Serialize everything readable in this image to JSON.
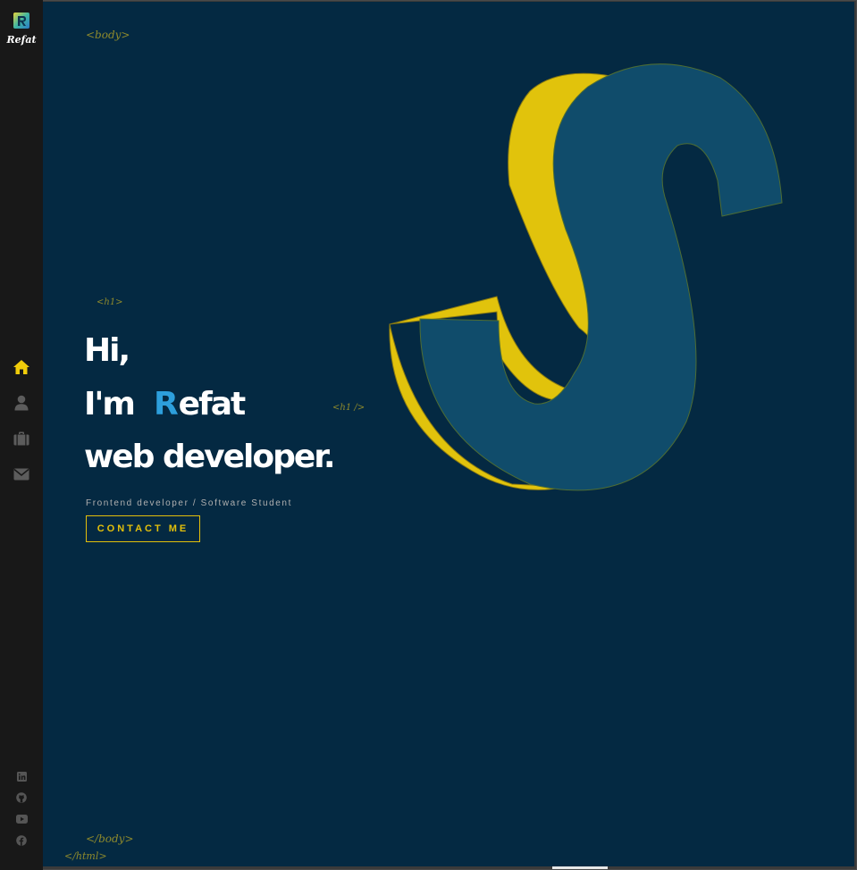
{
  "sidebar": {
    "logo_text": "Refat",
    "nav": [
      {
        "icon": "home-icon",
        "active": true
      },
      {
        "icon": "user-icon",
        "active": false
      },
      {
        "icon": "briefcase-icon",
        "active": false
      },
      {
        "icon": "envelope-icon",
        "active": false
      }
    ],
    "social": [
      {
        "icon": "linkedin-icon"
      },
      {
        "icon": "github-icon"
      },
      {
        "icon": "youtube-icon"
      },
      {
        "icon": "facebook-icon"
      }
    ]
  },
  "tags": {
    "body_open": "<body>",
    "h1_open": "<h1>",
    "h1_close": "<h1 />",
    "body_close": "</body>",
    "html_close": "</html>"
  },
  "hero": {
    "line1": "Hi,",
    "line2_prefix": "I'm",
    "logo_letter": "R",
    "line2_name": "efat",
    "line3": "web developer.",
    "subtitle": "Frontend developer / Software Student",
    "cta_label": "CONTACT ME"
  },
  "colors": {
    "accent": "#e3c00b",
    "background": "#042942",
    "sidebar": "#181818",
    "logo_blue": "#2d9fdc",
    "s_face": "#104c6b",
    "s_side": "#e1c30c"
  }
}
